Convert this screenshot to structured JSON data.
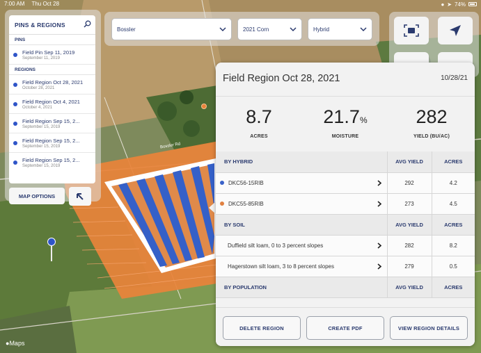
{
  "status_bar": {
    "time": "7:00 AM",
    "date": "Thu Oct 28",
    "battery": "74%"
  },
  "road_label": "Bossler Rd",
  "pins_panel": {
    "title": "PINS & REGIONS",
    "pins_label": "PINS",
    "pins": [
      {
        "title": "Field Pin Sep 11, 2019",
        "date": "September 11, 2019"
      }
    ],
    "regions_label": "REGIONS",
    "regions": [
      {
        "title": "Field Region Oct 28, 2021",
        "date": "October 28, 2021"
      },
      {
        "title": "Field Region Oct 4, 2021",
        "date": "October 4, 2021"
      },
      {
        "title": "Field Region Sep 15, 2...",
        "date": "September 15, 2019"
      },
      {
        "title": "Field Region Sep 15, 2...",
        "date": "September 15, 2019"
      },
      {
        "title": "Field Region Sep 15, 2...",
        "date": "September 15, 2019"
      }
    ],
    "map_options_label": "MAP OPTIONS"
  },
  "filters": {
    "field": "Bossler",
    "season": "2021 Corn",
    "layer": "Hybrid"
  },
  "detail": {
    "title": "Field Region Oct 28, 2021",
    "date": "10/28/21",
    "stats": [
      {
        "value": "8.7",
        "unit": "",
        "label": "ACRES"
      },
      {
        "value": "21.7",
        "unit": "%",
        "label": "MOISTURE"
      },
      {
        "value": "282",
        "unit": "",
        "label": "YIELD (BU/AC)"
      }
    ],
    "hybrid_header": {
      "name": "BY HYBRID",
      "avg": "AVG YIELD",
      "acres": "ACRES"
    },
    "hybrids": [
      {
        "name": "DKC56-15RIB",
        "avg": "292",
        "acres": "4.2",
        "color": "#3a62c9"
      },
      {
        "name": "DKC55-85RIB",
        "avg": "273",
        "acres": "4.5",
        "color": "#e08040"
      }
    ],
    "soil_header": {
      "name": "BY SOIL",
      "avg": "AVG YIELD",
      "acres": "ACRES"
    },
    "soils": [
      {
        "name": "Duffield silt loam, 0 to 3 percent slopes",
        "avg": "282",
        "acres": "8.2"
      },
      {
        "name": "Hagerstown silt loam, 3 to 8 percent slopes",
        "avg": "279",
        "acres": "0.5"
      }
    ],
    "population_header": {
      "name": "BY POPULATION",
      "avg": "AVG YIELD",
      "acres": "ACRES"
    },
    "buttons": {
      "delete": "DELETE REGION",
      "pdf": "CREATE PDF",
      "view": "VIEW REGION DETAILS"
    }
  },
  "maps_logo": "Maps",
  "colors": {
    "accent": "#2a3a6e",
    "field_orange": "#e8833a",
    "field_blue": "#3560c8",
    "pin_blue": "#2f55c8"
  }
}
